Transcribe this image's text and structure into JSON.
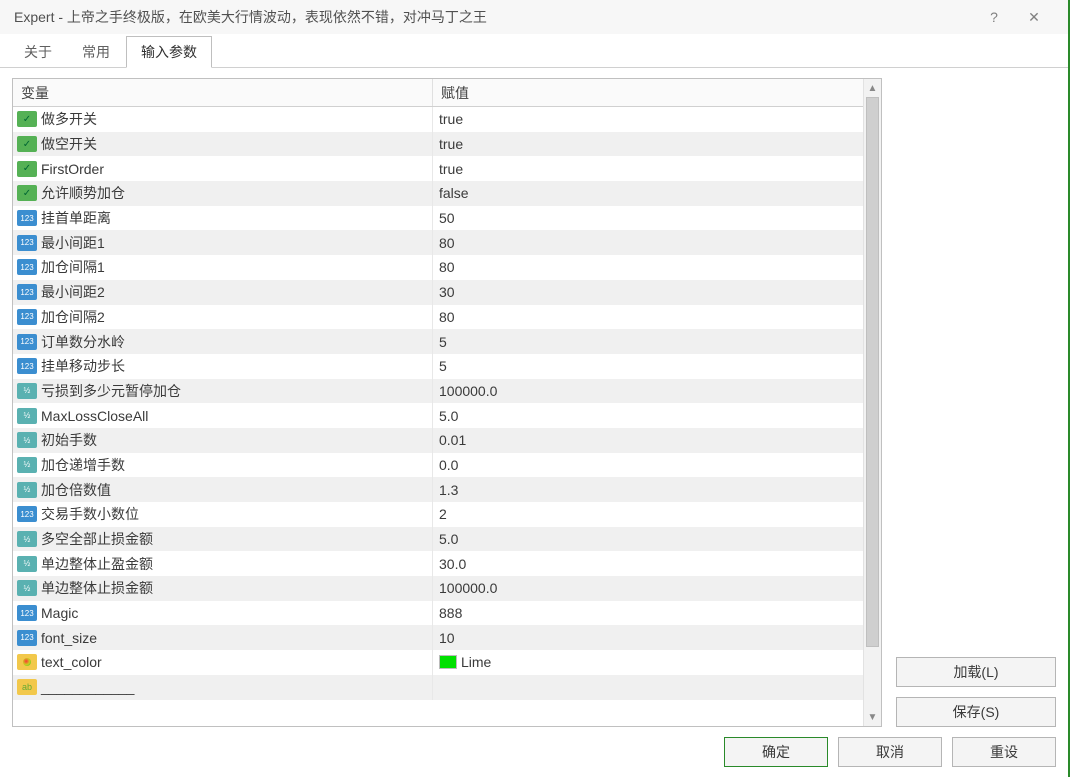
{
  "window": {
    "title": "Expert - 上帝之手终极版，在欧美大行情波动，表现依然不错，对冲马丁之王",
    "help": "?",
    "close": "✕"
  },
  "tabs": {
    "about": "关于",
    "common": "常用",
    "inputs": "输入参数"
  },
  "headers": {
    "variable": "变量",
    "value": "赋值"
  },
  "params": [
    {
      "icon": "bool",
      "name": "做多开关",
      "value": "true"
    },
    {
      "icon": "bool",
      "name": "做空开关",
      "value": "true"
    },
    {
      "icon": "bool",
      "name": "FirstOrder",
      "value": "true"
    },
    {
      "icon": "bool",
      "name": "允许顺势加仓",
      "value": "false"
    },
    {
      "icon": "int",
      "name": "挂首单距离",
      "value": "50"
    },
    {
      "icon": "int",
      "name": "最小间距1",
      "value": "80"
    },
    {
      "icon": "int",
      "name": "加仓间隔1",
      "value": "80"
    },
    {
      "icon": "int",
      "name": "最小间距2",
      "value": "30"
    },
    {
      "icon": "int",
      "name": "加仓间隔2",
      "value": "80"
    },
    {
      "icon": "int",
      "name": "订单数分水岭",
      "value": "5"
    },
    {
      "icon": "int",
      "name": "挂单移动步长",
      "value": "5"
    },
    {
      "icon": "float",
      "name": "亏损到多少元暂停加仓",
      "value": "100000.0"
    },
    {
      "icon": "float",
      "name": "MaxLossCloseAll",
      "value": "5.0"
    },
    {
      "icon": "float",
      "name": "初始手数",
      "value": "0.01"
    },
    {
      "icon": "float",
      "name": "加仓递增手数",
      "value": "0.0"
    },
    {
      "icon": "float",
      "name": "加仓倍数值",
      "value": "1.3"
    },
    {
      "icon": "int",
      "name": "交易手数小数位",
      "value": "2"
    },
    {
      "icon": "float",
      "name": "多空全部止损金额",
      "value": "5.0"
    },
    {
      "icon": "float",
      "name": "单边整体止盈金额",
      "value": "30.0"
    },
    {
      "icon": "float",
      "name": "单边整体止损金额",
      "value": "100000.0"
    },
    {
      "icon": "int",
      "name": "Magic",
      "value": "888"
    },
    {
      "icon": "int",
      "name": "font_size",
      "value": "10"
    },
    {
      "icon": "color",
      "name": "text_color",
      "value": "Lime",
      "swatch": "#00e000"
    },
    {
      "icon": "str",
      "name": "____________",
      "value": ""
    }
  ],
  "side": {
    "load": "加载(L)",
    "save": "保存(S)"
  },
  "bottom": {
    "ok": "确定",
    "cancel": "取消",
    "reset": "重设"
  },
  "icons": {
    "bool": "✓",
    "int": "123",
    "float": "½",
    "str": "ab"
  }
}
